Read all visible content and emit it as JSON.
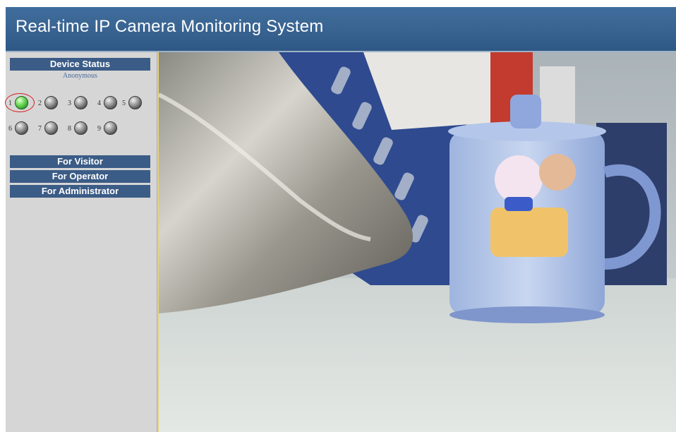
{
  "header": {
    "title": "Real-time IP Camera Monitoring System"
  },
  "sidebar": {
    "status_heading": "Device Status",
    "user": "Anonymous",
    "devices": [
      {
        "num": "1",
        "state": "online"
      },
      {
        "num": "2",
        "state": "offline"
      },
      {
        "num": "3",
        "state": "offline"
      },
      {
        "num": "4",
        "state": "offline"
      },
      {
        "num": "5",
        "state": "offline"
      },
      {
        "num": "6",
        "state": "offline"
      },
      {
        "num": "7",
        "state": "offline"
      },
      {
        "num": "8",
        "state": "offline"
      },
      {
        "num": "9",
        "state": "offline"
      }
    ],
    "menu": {
      "visitor": "For Visitor",
      "operator": "For Operator",
      "administrator": "For Administrator"
    }
  },
  "colors": {
    "header": "#3a6592",
    "section_heading": "#3b5c86",
    "sidebar_bg": "#d6d6d6",
    "online": "#33a82a",
    "offline": "#555555",
    "selected_ring": "#d61f1f"
  }
}
